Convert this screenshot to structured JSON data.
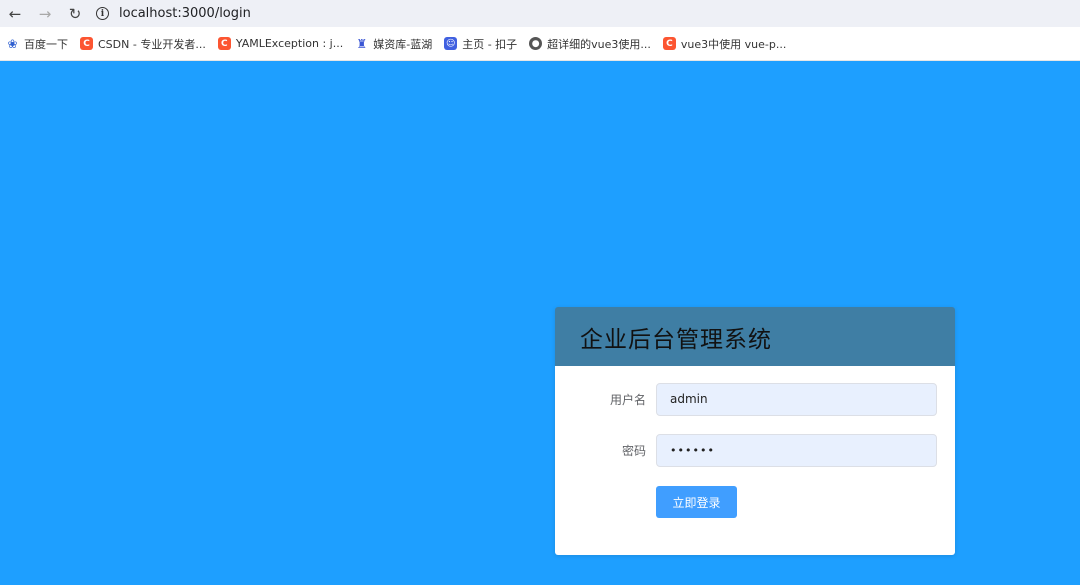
{
  "browser": {
    "url": "localhost:3000/login",
    "icons": {
      "back": "arrow-left-icon",
      "forward": "arrow-right-icon",
      "reload": "reload-icon",
      "site_info": "info-icon"
    },
    "bookmarks": [
      {
        "label": "百度一下",
        "icon": "baidu-paw-icon"
      },
      {
        "label": "CSDN - 专业开发者...",
        "icon": "csdn-icon"
      },
      {
        "label": "YAMLException : j...",
        "icon": "csdn-icon"
      },
      {
        "label": "媒资库-蓝湖",
        "icon": "lanhu-icon"
      },
      {
        "label": "主页 - 扣子",
        "icon": "coze-icon"
      },
      {
        "label": "超详细的vue3使用...",
        "icon": "globe-icon"
      },
      {
        "label": "vue3中使用 vue-p...",
        "icon": "csdn-icon"
      }
    ]
  },
  "login": {
    "title": "企业后台管理系统",
    "username_label": "用户名",
    "username_value": "admin",
    "password_label": "密码",
    "password_value": "••••••",
    "submit_label": "立即登录"
  },
  "colors": {
    "page_background": "#1e9fff",
    "card_header": "#3f7ea4",
    "button": "#409eff",
    "input_autofill": "#e8f0fe"
  }
}
